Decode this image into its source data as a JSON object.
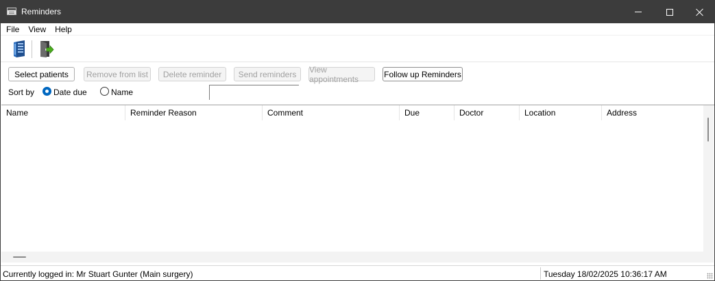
{
  "window": {
    "title": "Reminders",
    "icon": "app-window-icon"
  },
  "menu": {
    "items": [
      "File",
      "View",
      "Help"
    ]
  },
  "toolbar": {
    "icons": [
      {
        "name": "server-icon"
      },
      {
        "name": "exit-door-icon"
      }
    ]
  },
  "actions": {
    "select_patients": "Select patients",
    "remove_from_list": "Remove from list",
    "delete_reminder": "Delete reminder",
    "send_reminders": "Send reminders",
    "view_appointments": "View appointments",
    "follow_up": "Follow up Reminders"
  },
  "sort": {
    "label": "Sort by",
    "options": [
      "Date due",
      "Name"
    ],
    "selected": "Date due",
    "search_value": ""
  },
  "grid": {
    "columns": [
      "Name",
      "Reminder Reason",
      "Comment",
      "Due",
      "Doctor",
      "Location",
      "Address"
    ],
    "rows": []
  },
  "status": {
    "logged_in": "Currently logged in:  Mr Stuart Gunter (Main surgery)",
    "datetime": "Tuesday 18/02/2025 10:36:17 AM"
  },
  "colors": {
    "titlebar": "#3c3c3c",
    "accent": "#0067c0",
    "disabled_text": "#a0a0a0"
  }
}
